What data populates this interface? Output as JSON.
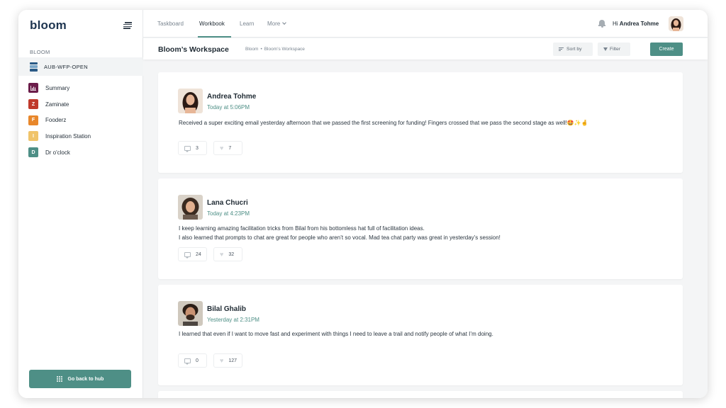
{
  "sidebar": {
    "logo": "bloom",
    "section_label": "BLOOM",
    "active_workspace": "AUB-WFP-OPEN",
    "items": [
      {
        "label": "Summary",
        "badge": "",
        "color": "#6b1d4a"
      },
      {
        "label": "Zaminate",
        "badge": "Z",
        "color": "#c0392b"
      },
      {
        "label": "Fooderz",
        "badge": "F",
        "color": "#e8872b"
      },
      {
        "label": "Inspiration Station",
        "badge": "I",
        "color": "#f0c46a"
      },
      {
        "label": "Dr o'clock",
        "badge": "D",
        "color": "#4e8f86"
      }
    ],
    "hub_button": "Go back to hub"
  },
  "topnav": {
    "tabs": [
      {
        "label": "Taskboard"
      },
      {
        "label": "Workbook",
        "active": true
      },
      {
        "label": "Learn"
      },
      {
        "label": "More"
      }
    ],
    "greeting_prefix": "Hi",
    "user_name": "Andrea Tohme"
  },
  "subheader": {
    "title": "Bloom’s Workspace",
    "breadcrumb": [
      "Bloom",
      "Bloom’s Workspace"
    ],
    "sort_label": "Sort by",
    "filter_label": "Filter",
    "create_label": "Create"
  },
  "posts": [
    {
      "author": "Andrea Tohme",
      "time": "Today at 5:06PM",
      "lines": [
        "Received a super exciting email yesterday afternoon that we passed the first screening for funding! Fingers crossed that we pass the second stage as well!🤩✨🤞"
      ],
      "comments": "3",
      "likes": "7"
    },
    {
      "author": "Lana Chucri",
      "time": "Today at 4:23PM",
      "lines": [
        "I keep learning amazing facilitation tricks from Bilal from his bottomless hat full of facilitation ideas.",
        "I also learned that prompts to chat are great for people who aren’t so vocal. Mad tea chat party was great in yesterday’s session!"
      ],
      "comments": "24",
      "likes": "32"
    },
    {
      "author": "Bilal Ghalib",
      "time": "Yesterday at 2:31PM",
      "lines": [
        "I learned that even if I want to move fast and experiment with things I need to leave a trail and notify people of what I’m doing."
      ],
      "comments": "0",
      "likes": "127"
    }
  ],
  "colors": {
    "accent": "#4e8f86",
    "brand": "#1e3550"
  }
}
